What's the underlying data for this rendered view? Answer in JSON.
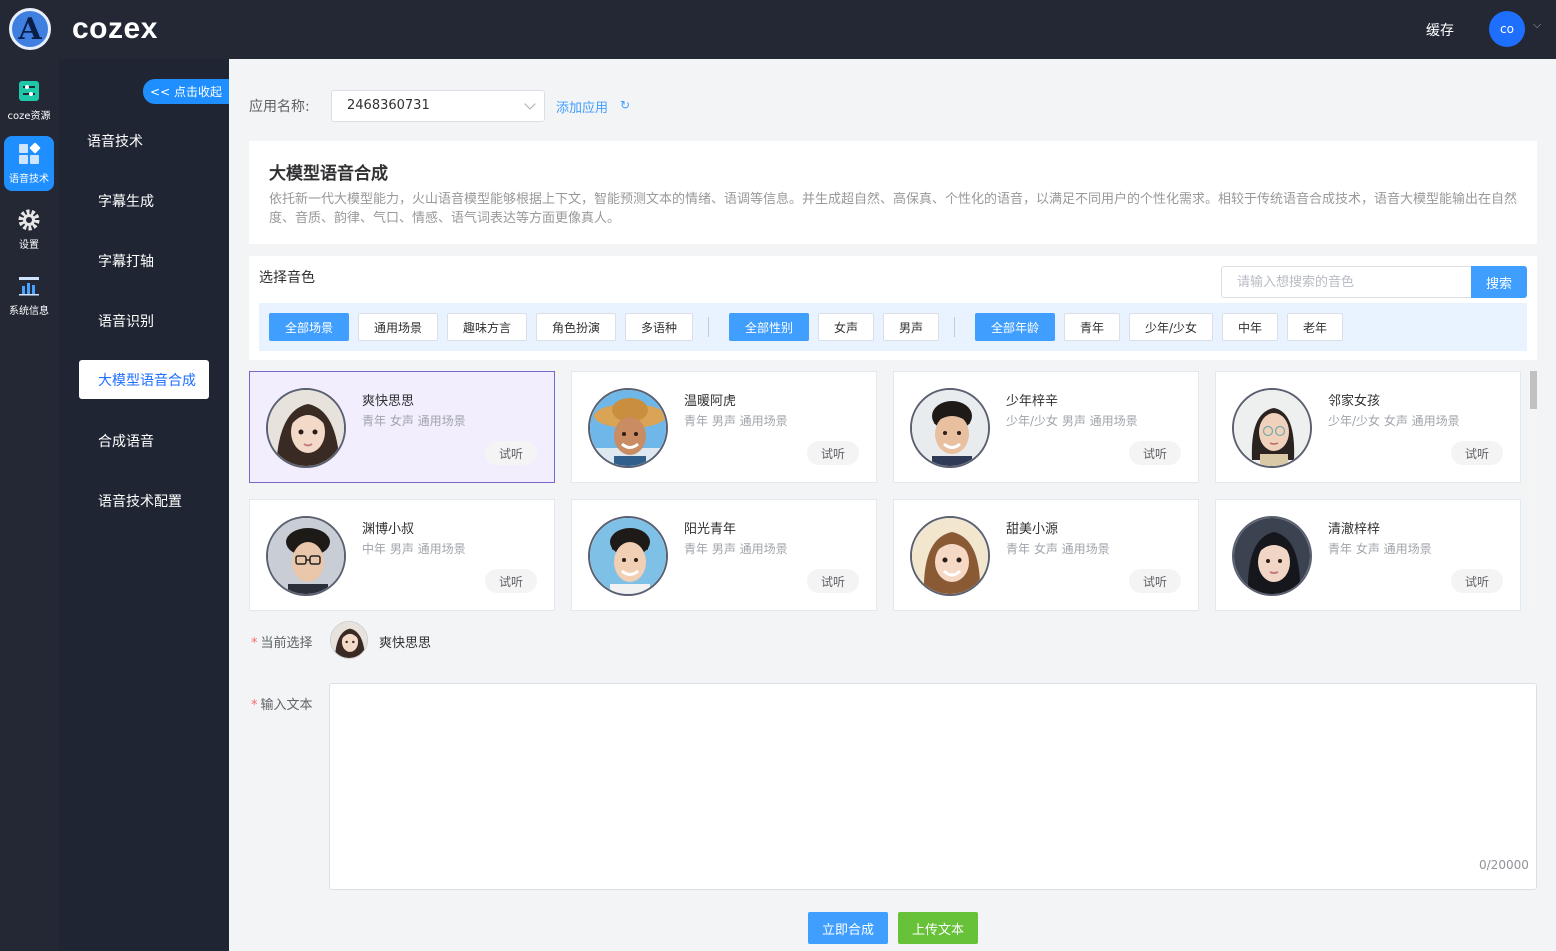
{
  "header": {
    "brand": "cozex",
    "logo_letter": "A",
    "cache_label": "缓存",
    "user_initials": "co"
  },
  "rail": [
    {
      "label": "coze资源",
      "icon": "sliders-icon"
    },
    {
      "label": "语音技术",
      "icon": "apps-icon",
      "active": true
    },
    {
      "label": "设置",
      "icon": "gear-icon"
    },
    {
      "label": "系统信息",
      "icon": "chart-icon"
    }
  ],
  "submenu": {
    "collapse_label": "<< 点击收起",
    "heading": "语音技术",
    "items": [
      {
        "label": "字幕生成"
      },
      {
        "label": "字幕打轴"
      },
      {
        "label": "语音识别"
      },
      {
        "label": "大模型语音合成",
        "active": true
      },
      {
        "label": "合成语音"
      },
      {
        "label": "语音技术配置"
      }
    ]
  },
  "app": {
    "label": "应用名称:",
    "selected": "2468360731",
    "add_label": "添加应用",
    "refresh_icon": "refresh-icon"
  },
  "intro": {
    "title": "大模型语音合成",
    "description": "依托新一代大模型能力，火山语音模型能够根据上下文，智能预测文本的情绪、语调等信息。并生成超自然、高保真、个性化的语音，以满足不同用户的个性化需求。相较于传统语音合成技术，语音大模型能输出在自然度、音质、韵律、气口、情感、语气词表达等方面更像真人。"
  },
  "voice_select": {
    "label": "选择音色",
    "search_placeholder": "请输入想搜索的音色",
    "search_button": "搜索",
    "scene_filters": [
      "全部场景",
      "通用场景",
      "趣味方言",
      "角色扮演",
      "多语种"
    ],
    "gender_filters": [
      "全部性别",
      "女声",
      "男声"
    ],
    "age_filters": [
      "全部年龄",
      "青年",
      "少年/少女",
      "中年",
      "老年"
    ]
  },
  "voices": [
    {
      "name": "爽快思思",
      "tags": "青年 女声 通用场景",
      "try": "试听",
      "selected": true
    },
    {
      "name": "温暖阿虎",
      "tags": "青年 男声 通用场景",
      "try": "试听"
    },
    {
      "name": "少年梓辛",
      "tags": "少年/少女 男声 通用场景",
      "try": "试听"
    },
    {
      "name": "邻家女孩",
      "tags": "少年/少女 女声 通用场景",
      "try": "试听"
    },
    {
      "name": "渊博小叔",
      "tags": "中年 男声 通用场景",
      "try": "试听"
    },
    {
      "name": "阳光青年",
      "tags": "青年 男声 通用场景",
      "try": "试听"
    },
    {
      "name": "甜美小源",
      "tags": "青年 女声 通用场景",
      "try": "试听"
    },
    {
      "name": "清澈梓梓",
      "tags": "青年 女声 通用场景",
      "try": "试听"
    }
  ],
  "current": {
    "label": "当前选择",
    "name": "爽快思思"
  },
  "text_input": {
    "label": "输入文本",
    "value": "",
    "counter": "0/20000"
  },
  "actions": {
    "synthesize": "立即合成",
    "upload": "上传文本"
  },
  "colors": {
    "primary": "#409eff",
    "success": "#67c23a",
    "sidebar": "#232834",
    "selected_card": "#f2eefe"
  }
}
